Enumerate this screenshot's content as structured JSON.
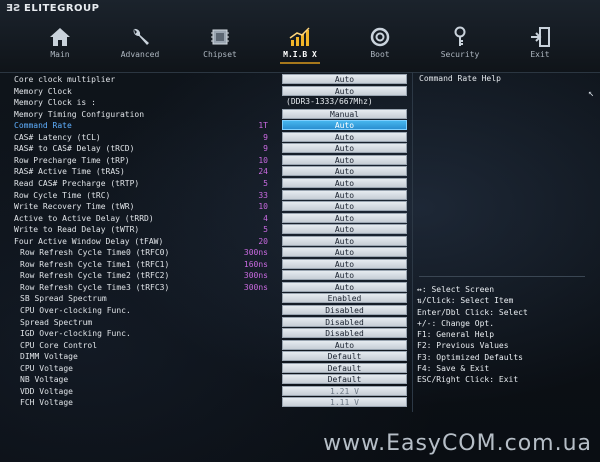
{
  "brand": {
    "mark": "ƎƧ",
    "name": "ELITEGROUP"
  },
  "tabs": [
    {
      "label": "Main",
      "icon": "home-icon"
    },
    {
      "label": "Advanced",
      "icon": "wrench-icon"
    },
    {
      "label": "Chipset",
      "icon": "chip-icon"
    },
    {
      "label": "M.I.B X",
      "icon": "chart-icon",
      "active": true
    },
    {
      "label": "Boot",
      "icon": "power-icon"
    },
    {
      "label": "Security",
      "icon": "key-icon"
    },
    {
      "label": "Exit",
      "icon": "exit-icon"
    }
  ],
  "settings": [
    {
      "label": "Core clock multiplier",
      "current": "",
      "value": "Auto",
      "style": "box"
    },
    {
      "label": "Memory Clock",
      "current": "",
      "value": "Auto",
      "style": "box"
    },
    {
      "label": "Memory Clock is :",
      "current": "",
      "value": "(DDR3-1333/667Mhz)",
      "style": "plain"
    },
    {
      "label": "Memory Timing Configuration",
      "current": "",
      "value": "Manual",
      "style": "box"
    },
    {
      "label": "Command Rate",
      "current": "1T",
      "value": "Auto",
      "style": "sel"
    },
    {
      "label": "CAS# Latency (tCL)",
      "current": "9",
      "value": "Auto",
      "style": "box"
    },
    {
      "label": "RAS# to CAS# Delay (tRCD)",
      "current": "9",
      "value": "Auto",
      "style": "box"
    },
    {
      "label": "Row Precharge Time (tRP)",
      "current": "10",
      "value": "Auto",
      "style": "box"
    },
    {
      "label": "RAS# Active Time (tRAS)",
      "current": "24",
      "value": "Auto",
      "style": "box"
    },
    {
      "label": "Read CAS# Precharge (tRTP)",
      "current": "5",
      "value": "Auto",
      "style": "box"
    },
    {
      "label": "Row Cycle Time (tRC)",
      "current": "33",
      "value": "Auto",
      "style": "box"
    },
    {
      "label": "Write Recovery Time (tWR)",
      "current": "10",
      "value": "Auto",
      "style": "box"
    },
    {
      "label": "Active to Active Delay (tRRD)",
      "current": "4",
      "value": "Auto",
      "style": "box"
    },
    {
      "label": "Write to Read Delay (tWTR)",
      "current": "5",
      "value": "Auto",
      "style": "box"
    },
    {
      "label": "Four Active Window Delay (tFAW)",
      "current": "20",
      "value": "Auto",
      "style": "box"
    },
    {
      "label": "Row Refresh Cycle Time0 (tRFC0)",
      "current": "300ns",
      "value": "Auto",
      "style": "box"
    },
    {
      "label": "Row Refresh Cycle Time1 (tRFC1)",
      "current": "160ns",
      "value": "Auto",
      "style": "box"
    },
    {
      "label": "Row Refresh Cycle Time2 (tRFC2)",
      "current": "300ns",
      "value": "Auto",
      "style": "box"
    },
    {
      "label": "Row Refresh Cycle Time3 (tRFC3)",
      "current": "300ns",
      "value": "Auto",
      "style": "box"
    },
    {
      "label": "SB Spread Spectrum",
      "current": "",
      "value": "Enabled",
      "style": "box"
    },
    {
      "label": "CPU Over-clocking Func.",
      "current": "",
      "value": "Disabled",
      "style": "box"
    },
    {
      "label": "Spread Spectrum",
      "current": "",
      "value": "Disabled",
      "style": "box"
    },
    {
      "label": "IGD Over-clocking Func.",
      "current": "",
      "value": "Disabled",
      "style": "box"
    },
    {
      "label": "CPU Core Control",
      "current": "",
      "value": "Auto",
      "style": "box"
    },
    {
      "label": "DIMM Voltage",
      "current": "",
      "value": "Default",
      "style": "box"
    },
    {
      "label": "CPU Voltage",
      "current": "",
      "value": "Default",
      "style": "box"
    },
    {
      "label": "NB Voltage",
      "current": "",
      "value": "Default",
      "style": "box"
    },
    {
      "label": "VDD Voltage",
      "current": "",
      "value": "1.21 V",
      "style": "dim"
    },
    {
      "label": "FCH Voltage",
      "current": "",
      "value": "1.11 V",
      "style": "dim"
    }
  ],
  "help": {
    "title": "Command Rate Help",
    "keys": [
      "↔: Select Screen",
      "⇅/Click: Select Item",
      "Enter/Dbl Click: Select",
      "+/-: Change Opt.",
      "F1: General Help",
      "F2: Previous Values",
      "F3: Optimized Defaults",
      "F4: Save & Exit",
      "ESC/Right Click: Exit"
    ]
  },
  "watermark": "www.EasyCOM.com.ua"
}
